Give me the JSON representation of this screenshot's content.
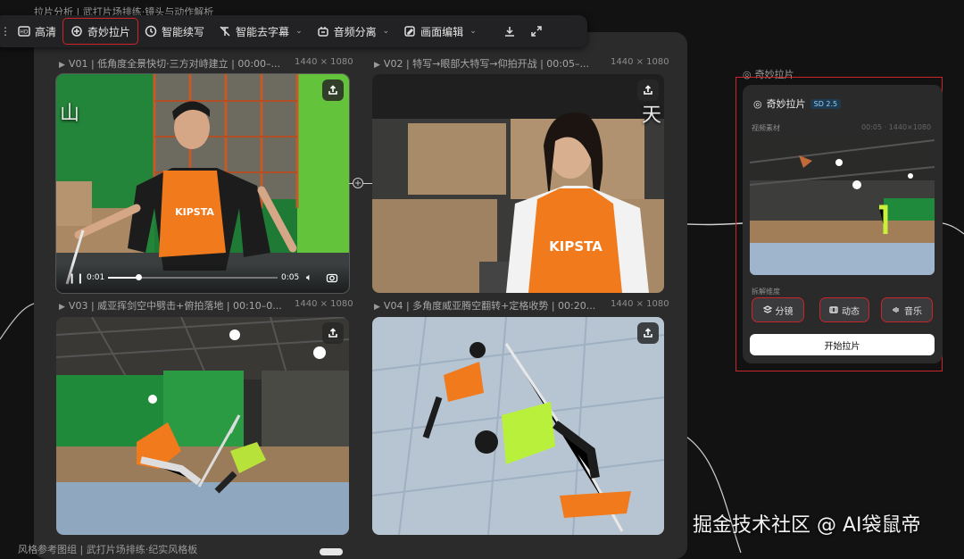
{
  "breadcrumb": "拉片分析 | 武打片场排练·镜头与动作解析",
  "toolbar": {
    "hd": "高清",
    "magic": "奇妙拉片",
    "continue": "智能续写",
    "subtitle": "智能去字幕",
    "audio": "音频分离",
    "edit": "画面编辑"
  },
  "clips": [
    {
      "title": "V01 | 低角度全景快切·三方对峙建立 | 00:00–...",
      "res": "1440 × 1080",
      "overlay_char": "山"
    },
    {
      "title": "V02 | 特写→眼部大特写→仰拍开战 | 00:05–...",
      "res": "1440 × 1080",
      "overlay_char": "天"
    },
    {
      "title": "V03 | 威亚挥剑空中劈击+俯拍落地 | 00:10–0...",
      "res": "1440 × 1080"
    },
    {
      "title": "V04 | 多角度威亚腾空翻转+定格收势 | 00:20...",
      "res": "1440 × 1080"
    }
  ],
  "player": {
    "current": "0:01",
    "duration": "0:05",
    "progress": 0.18
  },
  "vest_text": "KIPSTA",
  "node": {
    "label": "奇妙拉片",
    "title": "奇妙拉片",
    "badge": "SD 2.5",
    "material_label": "视频素材",
    "material_meta": "00:05 · 1440×1080",
    "dimension_label": "拆解维度",
    "options": [
      "分镜",
      "动态",
      "音乐"
    ],
    "start": "开始拉片"
  },
  "bottom_label_left": "风格参考图组 | 武打片场排练·纪实风格板",
  "watermark": "掘金技术社区 @ AI袋鼠帝"
}
